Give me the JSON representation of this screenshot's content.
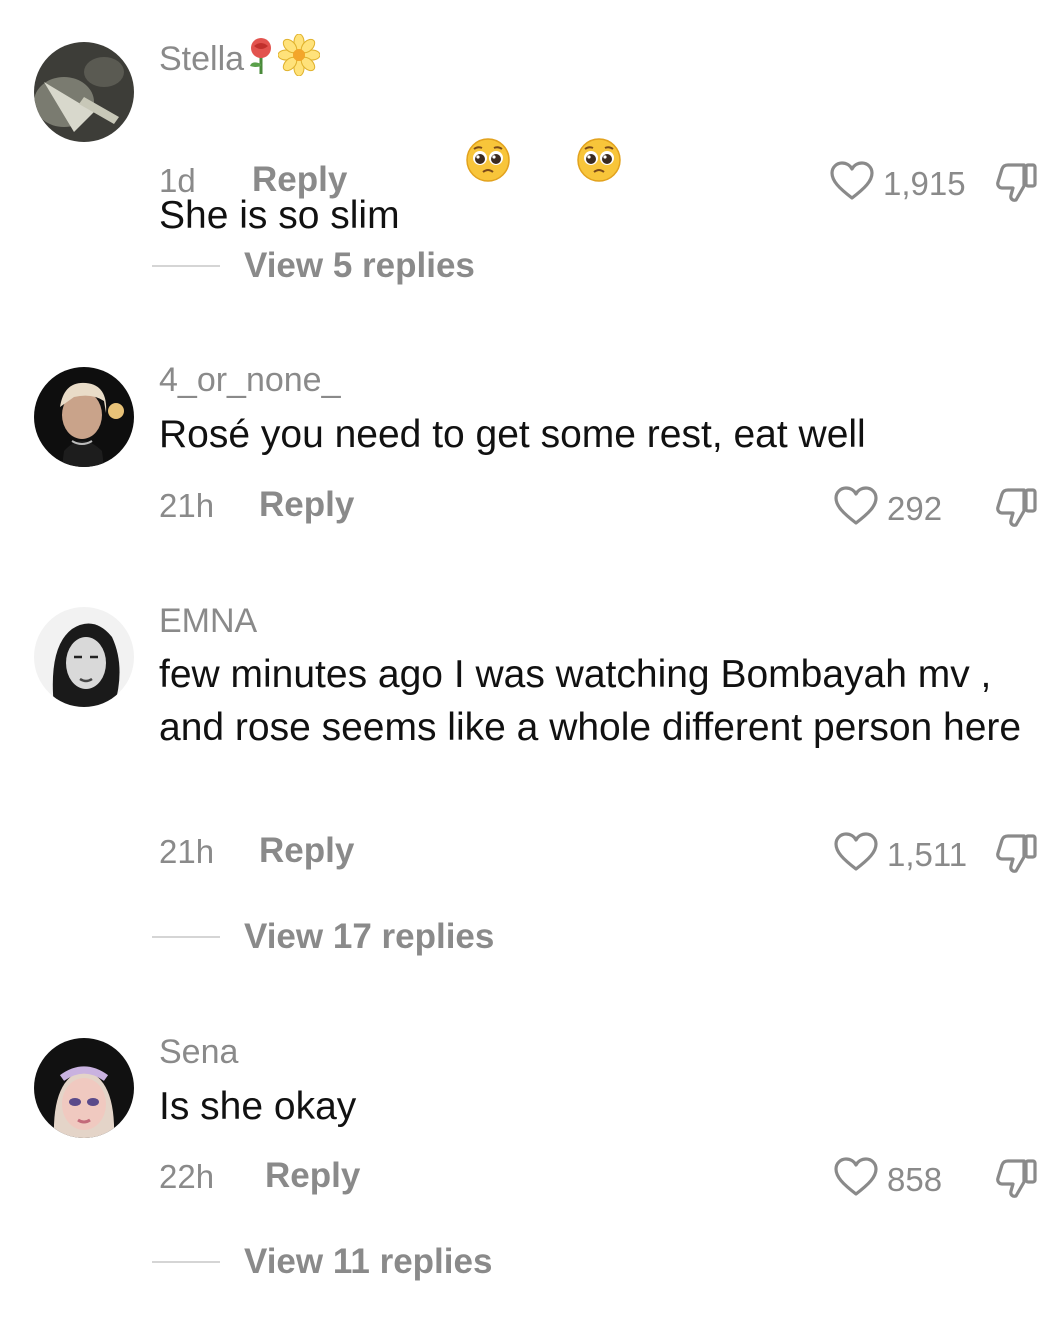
{
  "comments": [
    {
      "username": "Stella",
      "username_emoji": [
        "rose-icon",
        "blossom-icon"
      ],
      "text": "She is so slim",
      "text_emoji": [
        "pleading-face-icon",
        "pleading-face-icon"
      ],
      "time": "1d",
      "reply_label": "Reply",
      "likes": "1,915",
      "view_replies": "View 5 replies"
    },
    {
      "username": "4_or_none_",
      "text": "Rosé you need to get some rest, eat well",
      "time": "21h",
      "reply_label": "Reply",
      "likes": "292"
    },
    {
      "username": "EMNA",
      "text": "few minutes ago I was watching Bombayah mv , and rose seems like a whole different person here",
      "time": "21h",
      "reply_label": "Reply",
      "likes": "1,511",
      "view_replies": "View 17 replies"
    },
    {
      "username": "Sena",
      "text": "Is she okay",
      "time": "22h",
      "reply_label": "Reply",
      "likes": "858",
      "view_replies": "View 11 replies"
    }
  ],
  "colors": {
    "secondary_text": "#8a8a8a",
    "primary_text": "#111111",
    "divider": "#d5d5d5"
  }
}
